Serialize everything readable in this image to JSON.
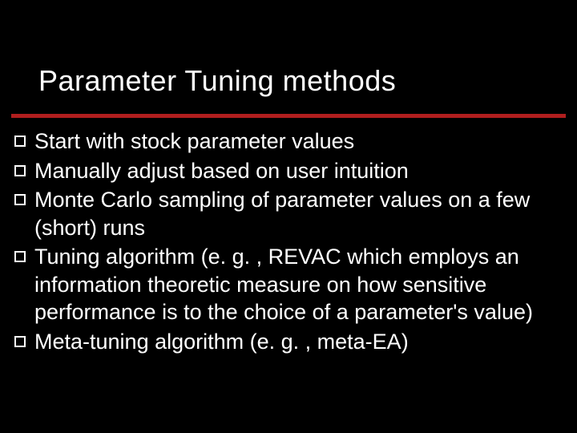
{
  "title": "Parameter Tuning methods",
  "bullets": [
    "Start with stock parameter values",
    "Manually adjust based on user intuition",
    "Monte Carlo sampling of parameter values on a few (short) runs",
    "Tuning algorithm (e. g. , REVAC which employs an information theoretic measure on how sensitive performance is to the choice of a parameter's value)",
    "Meta-tuning algorithm (e. g. , meta-EA)"
  ]
}
